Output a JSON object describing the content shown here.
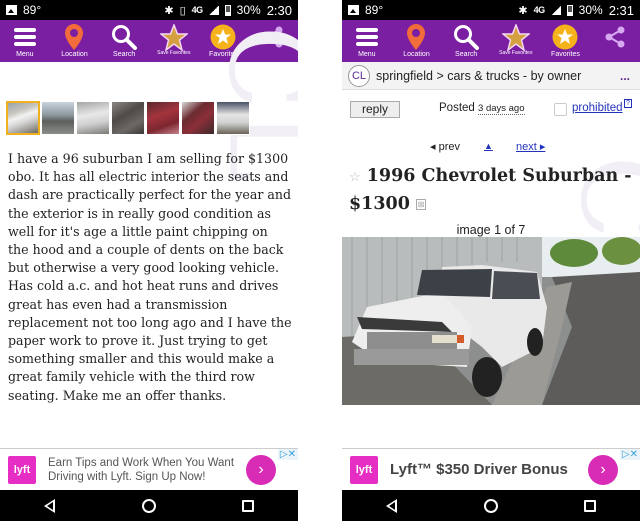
{
  "status_bar_left": {
    "temperature": "89°",
    "time": "2:30",
    "battery": "30%",
    "network": "4G LTE"
  },
  "status_bar_right": {
    "temperature": "89°",
    "time": "2:31",
    "battery": "30%",
    "network": "4G LTE"
  },
  "toolbar": {
    "items": [
      {
        "label": "Menu",
        "icon": "menu-icon"
      },
      {
        "label": "Location",
        "icon": "location-pin-icon"
      },
      {
        "label": "Search",
        "icon": "search-icon"
      },
      {
        "label": "Save Favorites",
        "icon": "star-icon"
      },
      {
        "label": "Favorites",
        "icon": "favorites-star-icon"
      },
      {
        "label": "",
        "icon": "share-icon"
      }
    ],
    "color": "#7b1fa2"
  },
  "listing_left": {
    "thumbnails_count": 7,
    "selected_thumbnail": 1,
    "description": "I have a 96 suburban I am selling for $1300 obo. It has all electric interior the seats and dash are practically perfect for the year and the exterior is in really good condition as well for it's age a little paint chipping on the hood and a couple of dents on the back but otherwise a very good looking vehicle. Has cold a.c. and hot heat runs and drives great has even had a transmission replacement not too long ago and I have the paper work to prove it. Just trying to get something smaller and this would make a great family vehicle with the third row seating. Make me an offer thanks."
  },
  "listing_right": {
    "badge": "CL",
    "breadcrumb": "springfield > cars & trucks - by owner",
    "more": "...",
    "reply_label": "reply",
    "posted_label": "Posted",
    "posted_ago": "3 days ago",
    "prohibited_label": "prohibited",
    "help_label": "?",
    "prev_label": "◂ prev",
    "up_label": "▲",
    "next_label": "next ▸",
    "star": "☆",
    "title": "1996 Chevrolet Suburban - $1300",
    "hide_icon": "⊠",
    "image_counter": "image 1 of 7"
  },
  "ad_left": {
    "logo": "lyft",
    "text": "Earn Tips and Work When You Want Driving with Lyft. Sign Up Now!",
    "cta": "›",
    "adchoices": "▷✕"
  },
  "ad_right": {
    "logo": "lyft",
    "text": "Lyft™ $350 Driver Bonus",
    "cta": "›",
    "adchoices": "▷✕"
  },
  "watermark": "CL"
}
